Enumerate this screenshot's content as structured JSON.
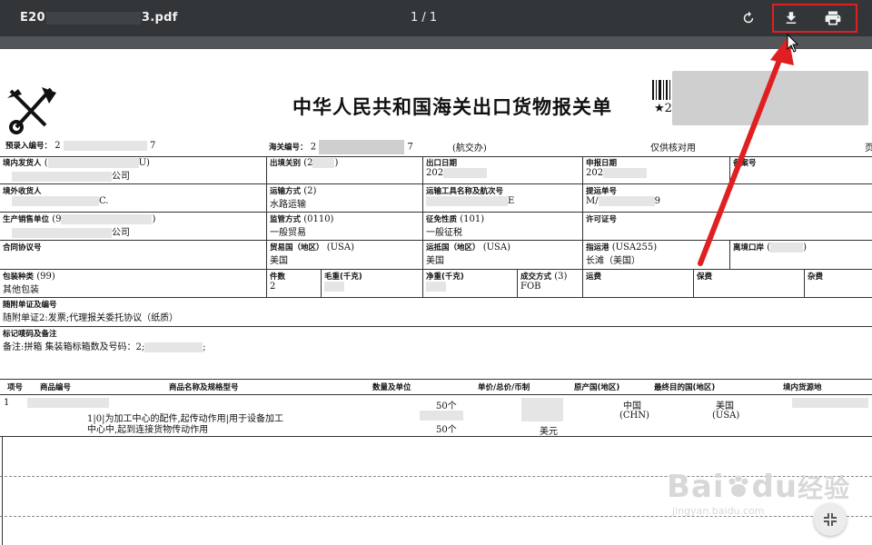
{
  "toolbar": {
    "file_name_start": "E20",
    "file_name_end": "3.pdf",
    "page_indicator": "1 / 1",
    "icons": [
      "rotate-icon",
      "download-icon",
      "print-icon"
    ],
    "highlight_color": "#e02020"
  },
  "form": {
    "title": "中华人民共和国海关出口货物报关单",
    "barcode_star": "★2",
    "pre_entry_label": "预录入编号：",
    "pre_entry_a": "2",
    "pre_entry_b": "7",
    "customs_no_label": "海关编号：",
    "customs_no_a": "2",
    "customs_no_b": "7",
    "customs_no_note": "(航交办)",
    "verify_note": "仅供核对用",
    "page_mark": "页",
    "domestic_consignor_label": "境内发货人",
    "domestic_consignor_open": "(",
    "domestic_consignor_close": "U)",
    "domestic_consignor_value": "公司",
    "exit_customs_label": "出境关别",
    "exit_customs_value": "(2",
    "exit_customs_close": ")",
    "export_date_label": "出口日期",
    "export_date_value": "202",
    "declare_date_label": "申报日期",
    "declare_date_value": "202",
    "record_no_label": "备案号",
    "overseas_consignee_label": "境外收货人",
    "overseas_consignee_value": "C.",
    "transport_mode_label": "运输方式",
    "transport_mode_code": "(2)",
    "transport_mode_value": "水路运输",
    "vessel_label": "运输工具名称及航次号",
    "vessel_value": "E",
    "bill_label": "提运单号",
    "bill_value_a": "M/",
    "bill_value_b": "9",
    "producer_label": "生产销售单位",
    "producer_code": "(9",
    "producer_close": ")",
    "producer_value": "公司",
    "supervision_label": "监管方式",
    "supervision_code": "(0110)",
    "supervision_value": "一般贸易",
    "tax_label": "征免性质",
    "tax_code": "(101)",
    "tax_value": "一般征税",
    "license_label": "许可证号",
    "contract_label": "合同协议号",
    "trade_country_label": "贸易国（地区）",
    "trade_country_code": "(USA)",
    "trade_country_value": "美国",
    "dest_country_label": "运抵国（地区）",
    "dest_country_code": "(USA)",
    "dest_country_value": "美国",
    "port_label": "指运港",
    "port_code": "(USA255)",
    "port_value": "长滩（美国）",
    "exit_port_label": "离境口岸",
    "exit_port_code": "(",
    "exit_port_close": ")",
    "package_label": "包装种类",
    "package_code": "(99)",
    "package_value": "其他包装",
    "pieces_label": "件数",
    "pieces_value": "2",
    "gross_label": "毛重(千克)",
    "net_label": "净重(千克)",
    "deal_label": "成交方式",
    "deal_code": "(3)",
    "deal_value": "FOB",
    "freight_label": "运费",
    "insurance_label": "保费",
    "misc_label": "杂费",
    "docs_label": "随附单证及编号",
    "docs_value": "随附单证2:发票;代理报关委托协议（纸质）",
    "marks_label": "标记唛码及备注",
    "marks_value": "备注:拼箱   集装箱标箱数及号码：2;",
    "marks_end": ";"
  },
  "goods": {
    "headers": [
      "项号",
      "商品编号",
      "商品名称及规格型号",
      "数量及单位",
      "单价/总价/币制",
      "原产国(地区)",
      "最终目的国(地区)",
      "境内货源地"
    ],
    "item_no": "1",
    "desc_line1": "1|0|为加工中心的配件,起传动作用|用于设备加工",
    "desc_line2": "中心中,起到连接货物传动作用",
    "qty1": "50个",
    "qty2": "50个",
    "currency": "美元",
    "origin": "中国",
    "origin_code": "(CHN)",
    "dest": "美国",
    "dest_code": "(USA)"
  },
  "watermark": {
    "brand": "Bai",
    "brand2": "du",
    "brand_cn": "经验",
    "site": "jingyan.baidu.com"
  }
}
